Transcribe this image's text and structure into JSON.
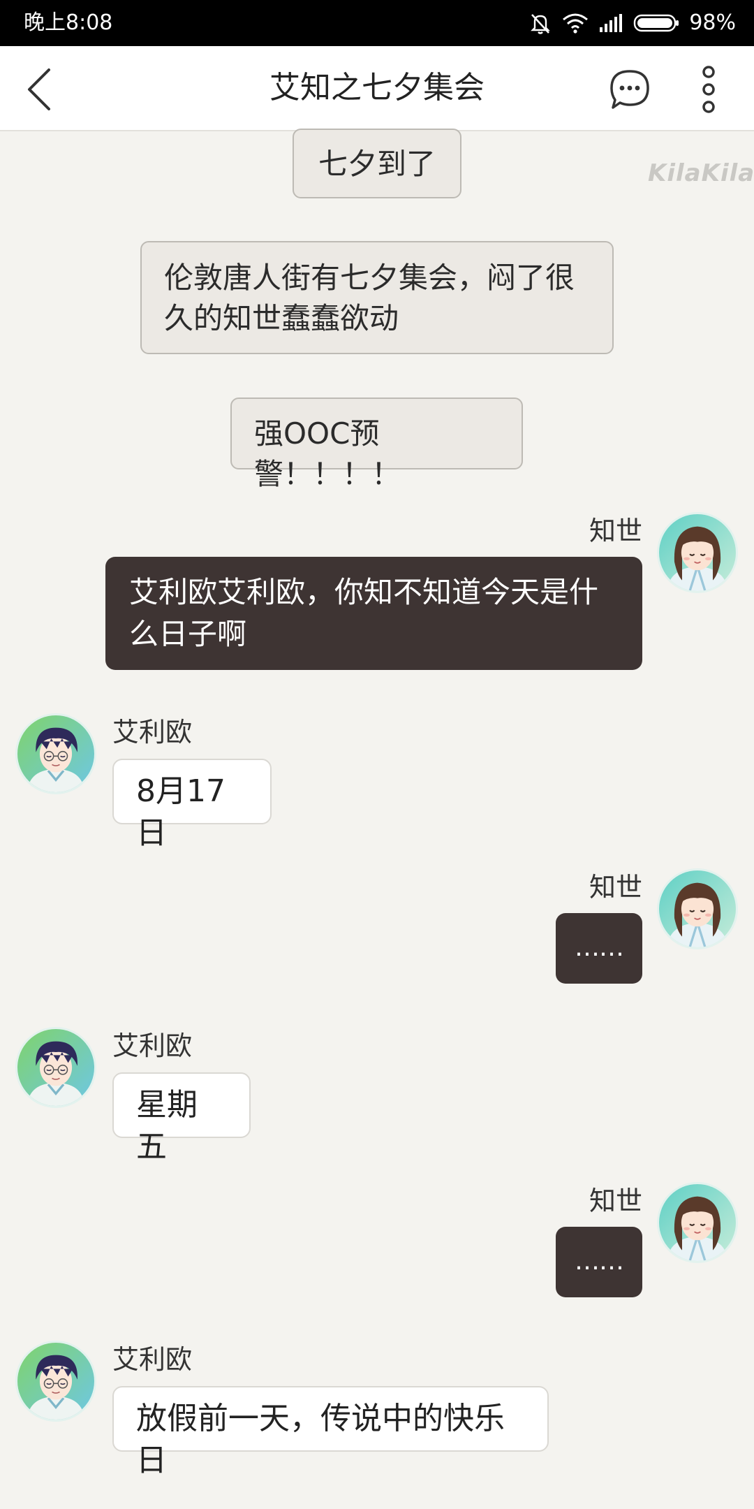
{
  "status_bar": {
    "time": "晚上8:08",
    "battery": "98%",
    "icons": [
      "mute-bell-icon",
      "wifi-icon",
      "signal-icon",
      "battery-icon"
    ]
  },
  "header": {
    "title": "艾知之七夕集会",
    "icons": [
      "back-arrow-icon",
      "chat-bubble-icon",
      "more-vertical-icon"
    ]
  },
  "watermark": "KilaKila",
  "narrations": [
    "七夕到了",
    "伦敦唐人街有七夕集会，闷了很久的知世蠢蠢欲动",
    "强OOC预警！！！！"
  ],
  "messages": [
    {
      "sender": "知世",
      "side": "right",
      "text": "艾利欧艾利欧，你知不知道今天是什么日子啊"
    },
    {
      "sender": "艾利欧",
      "side": "left",
      "text": "8月17日"
    },
    {
      "sender": "知世",
      "side": "right",
      "text": "……"
    },
    {
      "sender": "艾利欧",
      "side": "left",
      "text": "星期五"
    },
    {
      "sender": "知世",
      "side": "right",
      "text": "……"
    },
    {
      "sender": "艾利欧",
      "side": "left",
      "text": "放假前一天，传说中的快乐日"
    }
  ],
  "colors": {
    "background": "#f4f3ef",
    "dark_bubble": "#3e3433",
    "narration_bubble": "#ece9e4",
    "header": "#ffffff",
    "status_bar": "#000000"
  }
}
